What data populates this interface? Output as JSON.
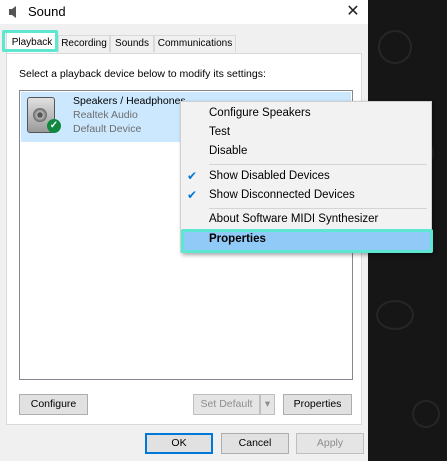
{
  "window": {
    "title": "Sound",
    "close_glyph": "✕"
  },
  "tabs": [
    {
      "label": "Playback",
      "active": true
    },
    {
      "label": "Recording",
      "active": false
    },
    {
      "label": "Sounds",
      "active": false
    },
    {
      "label": "Communications",
      "active": false
    }
  ],
  "playback": {
    "instruction": "Select a playback device below to modify its settings:",
    "device": {
      "name": "Speakers / Headphones",
      "driver": "Realtek Audio",
      "status": "Default Device",
      "icon": "speaker-icon",
      "badge_icon": "checkmark-icon"
    },
    "buttons": {
      "configure": "Configure",
      "set_default": "Set Default",
      "properties": "Properties"
    }
  },
  "footer": {
    "ok": "OK",
    "cancel": "Cancel",
    "apply": "Apply"
  },
  "context_menu": {
    "items": [
      "Configure Speakers",
      "Test",
      "Disable",
      "Show Disabled Devices",
      "Show Disconnected Devices",
      "About Software MIDI Synthesizer",
      "Properties"
    ],
    "check_glyph": "✔"
  },
  "colors": {
    "highlight": "#5de6d0",
    "selection": "#cce8ff",
    "menu_selected": "#91c9f7",
    "accent": "#0078d7"
  }
}
